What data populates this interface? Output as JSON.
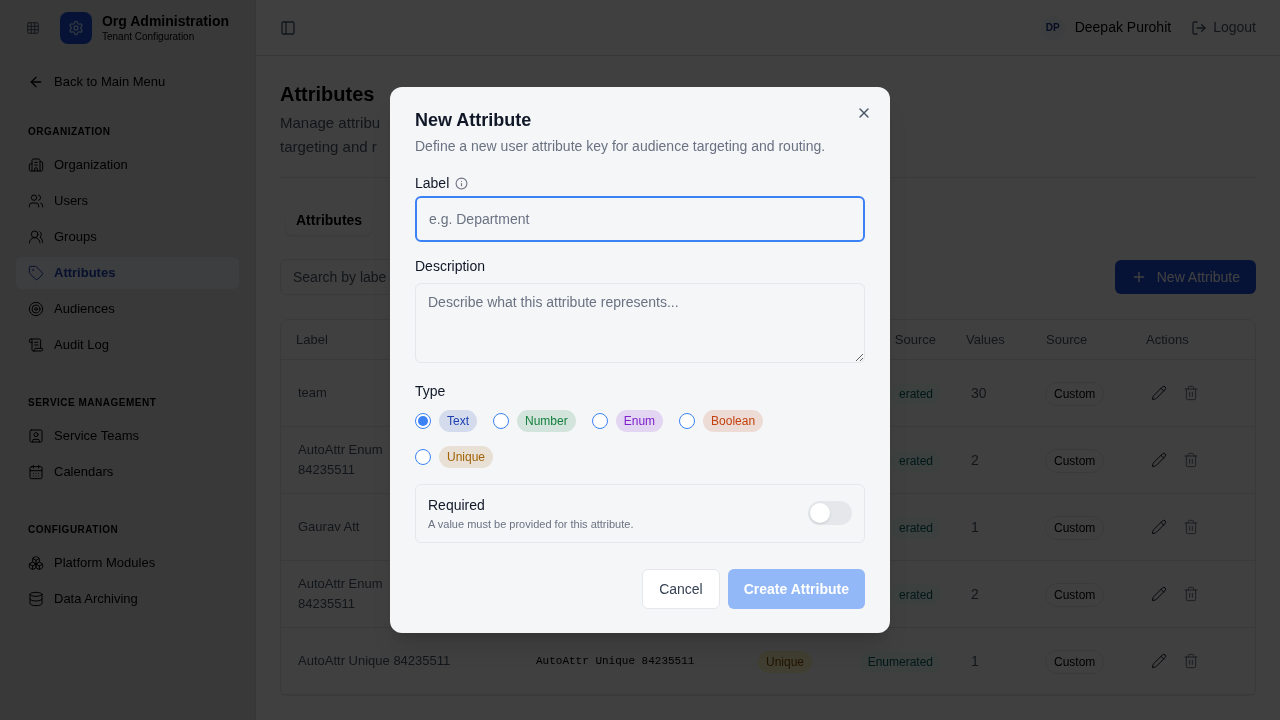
{
  "sidebar": {
    "title": "Org Administration",
    "subtitle": "Tenant Configuration",
    "back_link": "Back to Main Menu",
    "sections": [
      {
        "heading": "ORGANIZATION",
        "items": [
          {
            "label": "Organization",
            "selected": false
          },
          {
            "label": "Users",
            "selected": false
          },
          {
            "label": "Groups",
            "selected": false
          },
          {
            "label": "Attributes",
            "selected": true
          },
          {
            "label": "Audiences",
            "selected": false
          },
          {
            "label": "Audit Log",
            "selected": false
          }
        ]
      },
      {
        "heading": "SERVICE MANAGEMENT",
        "items": [
          {
            "label": "Service Teams",
            "selected": false
          },
          {
            "label": "Calendars",
            "selected": false
          }
        ]
      },
      {
        "heading": "CONFIGURATION",
        "items": [
          {
            "label": "Platform Modules",
            "selected": false
          },
          {
            "label": "Data Archiving",
            "selected": false
          }
        ]
      }
    ]
  },
  "topbar": {
    "avatar_initials": "DP",
    "user_name": "Deepak Purohit",
    "logout": "Logout"
  },
  "page": {
    "title": "Attributes",
    "description_lines": [
      "Manage attribu",
      "targeting and r"
    ],
    "tabs": [
      {
        "label": "Attributes",
        "selected": true
      }
    ],
    "search": {
      "placeholder": "Search by labe"
    },
    "new_button": "New Attribute",
    "table": {
      "columns": [
        "Label",
        "Source",
        "Values",
        "Source",
        "Actions"
      ],
      "rows": [
        {
          "label_lines": [
            "team"
          ],
          "data_source": "erated",
          "values": "30",
          "source": "Custom"
        },
        {
          "label_lines": [
            "AutoAttr Enum",
            "84235511"
          ],
          "data_source": "erated",
          "values": "2",
          "source": "Custom"
        },
        {
          "label_lines": [
            "Gaurav Att"
          ],
          "data_source": "erated",
          "values": "1",
          "source": "Custom"
        },
        {
          "label_lines": [
            "AutoAttr Enum",
            "84235511"
          ],
          "data_source": "erated",
          "values": "2",
          "source": "Custom"
        },
        {
          "label_lines": [
            "AutoAttr Unique 84235511"
          ],
          "key": "AutoAttr Unique 84235511",
          "type": "Unique",
          "data_source": "Enumerated",
          "values": "1",
          "source": "Custom"
        }
      ]
    }
  },
  "modal": {
    "title": "New Attribute",
    "description": "Define a new user attribute key for audience targeting and routing.",
    "label_field": {
      "label": "Label",
      "placeholder": "e.g. Department",
      "focused": true
    },
    "description_field": {
      "label": "Description",
      "placeholder": "Describe what this attribute represents..."
    },
    "type": {
      "label": "Type",
      "options": [
        {
          "label": "Text",
          "selected": true,
          "color": "#1e40af"
        },
        {
          "label": "Number",
          "selected": false,
          "color": "#15803d"
        },
        {
          "label": "Enum",
          "selected": false,
          "color": "#7e22ce"
        },
        {
          "label": "Boolean",
          "selected": false,
          "color": "#c2410c"
        },
        {
          "label": "Unique",
          "selected": false,
          "color": "#a16207"
        }
      ]
    },
    "required": {
      "title": "Required",
      "hint": "A value must be provided for this attribute.",
      "on": false
    },
    "cancel": "Cancel",
    "create": "Create Attribute",
    "create_disabled": true
  }
}
